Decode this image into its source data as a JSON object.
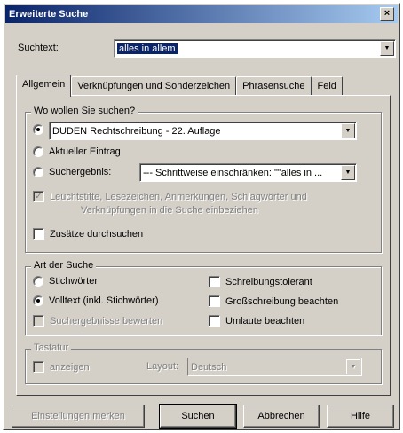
{
  "window": {
    "title": "Erweiterte Suche",
    "close": "×"
  },
  "search": {
    "label": "Suchtext:",
    "value": "alles in allem"
  },
  "tabs": [
    {
      "label": "Allgemein"
    },
    {
      "label": "Verknüpfungen und Sonderzeichen"
    },
    {
      "label": "Phrasensuche"
    },
    {
      "label": "Feld"
    }
  ],
  "where": {
    "legend": "Wo wollen Sie suchen?",
    "options": [
      {
        "label": "DUDEN Rechtschreibung - 22. Auflage",
        "checked": true
      },
      {
        "label": "Aktueller Eintrag",
        "checked": false
      },
      {
        "label": "Suchergebnis:",
        "checked": false
      }
    ],
    "book_combo": "DUDEN Rechtschreibung - 22. Auflage",
    "result_combo": "--- Schrittweise einschränken: \"\"alles in ...",
    "markers_label_line1": "Leuchtstifte, Lesezeichen, Anmerkungen, Schlagwörter und",
    "markers_label_line2": "Verknüpfungen in die Suche einbeziehen",
    "markers_checked": "✓",
    "supplements_label": "Zusätze durchsuchen"
  },
  "kind": {
    "legend": "Art der Suche",
    "keyword": "Stichwörter",
    "fulltext": "Volltext (inkl. Stichwörter)",
    "rate": "Suchergebnisse bewerten",
    "tolerant": "Schreibungstolerant",
    "case": "Großschreibung beachten",
    "umlaut": "Umlaute beachten"
  },
  "keyboard": {
    "legend": "Tastatur",
    "show": "anzeigen",
    "layout_label": "Layout:",
    "layout_value": "Deutsch"
  },
  "buttons": {
    "save": "Einstellungen merken",
    "search": "Suchen",
    "cancel": "Abbrechen",
    "help": "Hilfe"
  }
}
